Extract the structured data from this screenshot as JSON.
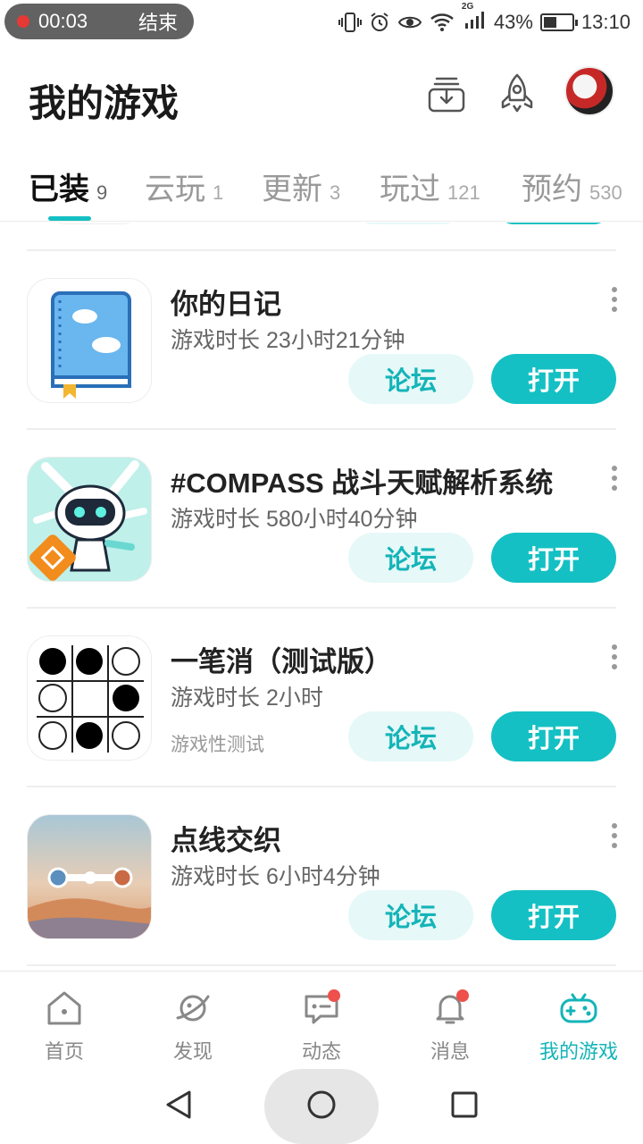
{
  "status_bar": {
    "recording_time": "00:03",
    "recording_end_label": "结束",
    "network": "2G",
    "battery": "43%",
    "time": "13:10"
  },
  "header": {
    "title": "我的游戏"
  },
  "tabs": [
    {
      "label": "已装",
      "count": "9",
      "active": true
    },
    {
      "label": "云玩",
      "count": "1",
      "active": false
    },
    {
      "label": "更新",
      "count": "3",
      "active": false
    },
    {
      "label": "玩过",
      "count": "121",
      "active": false
    },
    {
      "label": "预约",
      "count": "530",
      "active": false
    }
  ],
  "games": [
    {
      "name": "你的日记",
      "playtime": "游戏时长 23小时21分钟",
      "tag": "",
      "forum_label": "论坛",
      "open_label": "打开"
    },
    {
      "name": "#COMPASS 战斗天赋解析系统",
      "playtime": "游戏时长 580小时40分钟",
      "tag": "",
      "forum_label": "论坛",
      "open_label": "打开"
    },
    {
      "name": "一笔消（测试版）",
      "playtime": "游戏时长 2小时",
      "tag": "游戏性测试",
      "forum_label": "论坛",
      "open_label": "打开"
    },
    {
      "name": "点线交织",
      "playtime": "游戏时长 6小时4分钟",
      "tag": "",
      "forum_label": "论坛",
      "open_label": "打开"
    }
  ],
  "bottom_nav": [
    {
      "label": "首页",
      "icon": "home-icon",
      "badge": false,
      "active": false
    },
    {
      "label": "发现",
      "icon": "planet-icon",
      "badge": false,
      "active": false
    },
    {
      "label": "动态",
      "icon": "chat-icon",
      "badge": true,
      "active": false
    },
    {
      "label": "消息",
      "icon": "bell-icon",
      "badge": true,
      "active": false
    },
    {
      "label": "我的游戏",
      "icon": "gamepad-icon",
      "badge": false,
      "active": true
    }
  ],
  "colors": {
    "accent": "#14c0c3",
    "badge": "#f0504b"
  }
}
